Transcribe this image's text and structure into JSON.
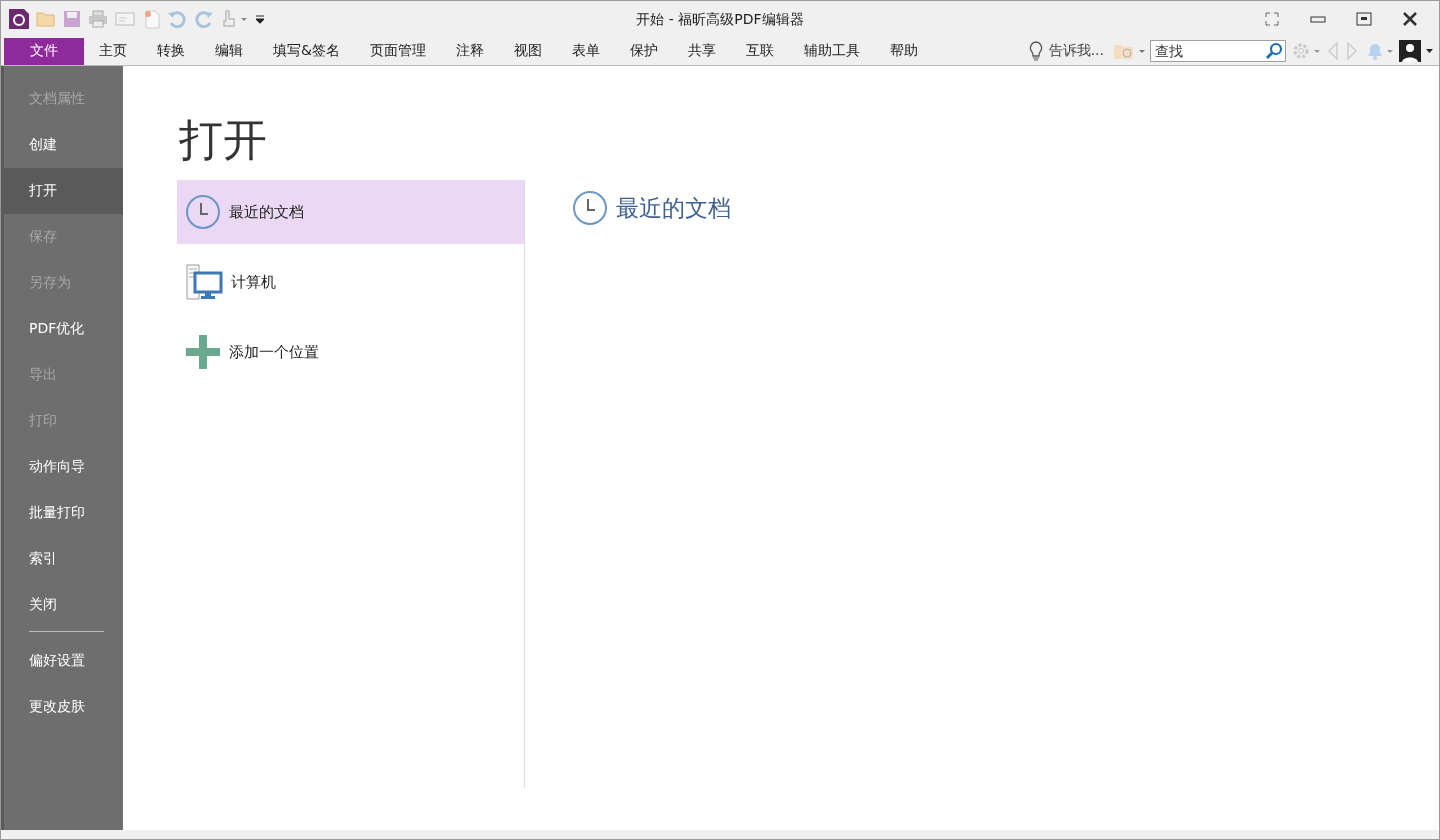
{
  "window": {
    "title": "开始 - 福昕高级PDF编辑器"
  },
  "menu_tabs": [
    {
      "label": "文件",
      "selected": true
    },
    {
      "label": "主页",
      "selected": false
    },
    {
      "label": "转换",
      "selected": false
    },
    {
      "label": "编辑",
      "selected": false
    },
    {
      "label": "填写&签名",
      "selected": false
    },
    {
      "label": "页面管理",
      "selected": false
    },
    {
      "label": "注释",
      "selected": false
    },
    {
      "label": "视图",
      "selected": false
    },
    {
      "label": "表单",
      "selected": false
    },
    {
      "label": "保护",
      "selected": false
    },
    {
      "label": "共享",
      "selected": false
    },
    {
      "label": "互联",
      "selected": false
    },
    {
      "label": "辅助工具",
      "selected": false
    },
    {
      "label": "帮助",
      "selected": false
    }
  ],
  "tell_me": {
    "label": "告诉我..."
  },
  "search": {
    "placeholder": "查找"
  },
  "sidebar": {
    "items": [
      {
        "kind": "item",
        "label": "文档属性",
        "disabled": true,
        "selected": false
      },
      {
        "kind": "item",
        "label": "创建",
        "disabled": false,
        "selected": false
      },
      {
        "kind": "item",
        "label": "打开",
        "disabled": false,
        "selected": true
      },
      {
        "kind": "item",
        "label": "保存",
        "disabled": true,
        "selected": false
      },
      {
        "kind": "item",
        "label": "另存为",
        "disabled": true,
        "selected": false
      },
      {
        "kind": "item",
        "label": "PDF优化",
        "disabled": false,
        "selected": false
      },
      {
        "kind": "item",
        "label": "导出",
        "disabled": true,
        "selected": false
      },
      {
        "kind": "item",
        "label": "打印",
        "disabled": true,
        "selected": false
      },
      {
        "kind": "item",
        "label": "动作向导",
        "disabled": false,
        "selected": false
      },
      {
        "kind": "item",
        "label": "批量打印",
        "disabled": false,
        "selected": false
      },
      {
        "kind": "item",
        "label": "索引",
        "disabled": false,
        "selected": false
      },
      {
        "kind": "item",
        "label": "关闭",
        "disabled": false,
        "selected": false
      },
      {
        "kind": "divider"
      },
      {
        "kind": "item",
        "label": "偏好设置",
        "disabled": false,
        "selected": false
      },
      {
        "kind": "item",
        "label": "更改皮肤",
        "disabled": false,
        "selected": false
      }
    ]
  },
  "main": {
    "heading": "打开",
    "locations": [
      {
        "kind": "recent",
        "label": "最近的文档",
        "selected": true
      },
      {
        "kind": "computer",
        "label": "计算机",
        "selected": false
      },
      {
        "kind": "add",
        "label": "添加一个位置",
        "selected": false
      }
    ],
    "panel": {
      "heading": "最近的文档"
    }
  }
}
